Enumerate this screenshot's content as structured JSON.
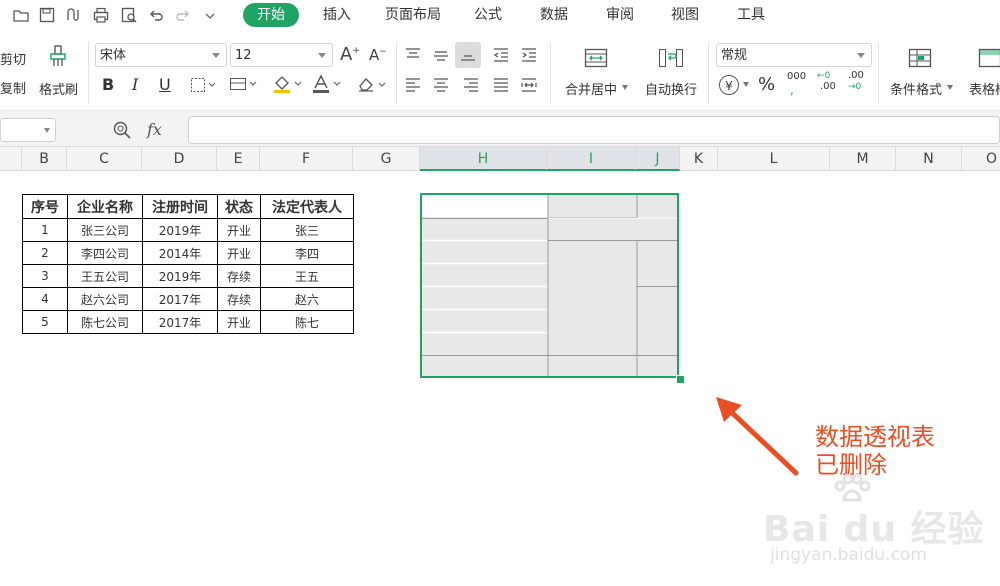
{
  "menu": {
    "items": [
      "开始",
      "插入",
      "页面布局",
      "公式",
      "数据",
      "审阅",
      "视图",
      "工具"
    ],
    "active": "开始"
  },
  "ribbon": {
    "cut": "剪切",
    "copy": "复制",
    "format_painter": "格式刷",
    "font_name": "宋体",
    "font_size": "12",
    "bold": "B",
    "italic": "I",
    "underline": "U",
    "merge_center": "合并居中",
    "auto_wrap": "自动换行",
    "number_format": "常规",
    "currency_symbol": "¥",
    "percent": "%",
    "thousands": "000",
    "increase_decimal": ".00",
    "decrease_decimal": ".00",
    "conditional_format": "条件格式",
    "table_style": "表格样"
  },
  "formula_bar": {
    "fx_label": "fx",
    "value": ""
  },
  "columns": [
    "B",
    "C",
    "D",
    "E",
    "F",
    "G",
    "H",
    "I",
    "J",
    "K",
    "L",
    "M",
    "N",
    "O"
  ],
  "table": {
    "headers": [
      "序号",
      "企业名称",
      "注册时间",
      "状态",
      "法定代表人"
    ],
    "rows": [
      [
        "1",
        "张三公司",
        "2019年",
        "开业",
        "张三"
      ],
      [
        "2",
        "李四公司",
        "2014年",
        "开业",
        "李四"
      ],
      [
        "3",
        "王五公司",
        "2019年",
        "存续",
        "王五"
      ],
      [
        "4",
        "赵六公司",
        "2017年",
        "存续",
        "赵六"
      ],
      [
        "5",
        "陈七公司",
        "2017年",
        "开业",
        "陈七"
      ]
    ]
  },
  "annotation": {
    "line1": "数据透视表",
    "line2": "已删除",
    "color": "#e84f25"
  },
  "accent_color": "#21a366",
  "watermark": {
    "brand": "Bai du 经验",
    "url": "jingyan.baidu.com"
  }
}
